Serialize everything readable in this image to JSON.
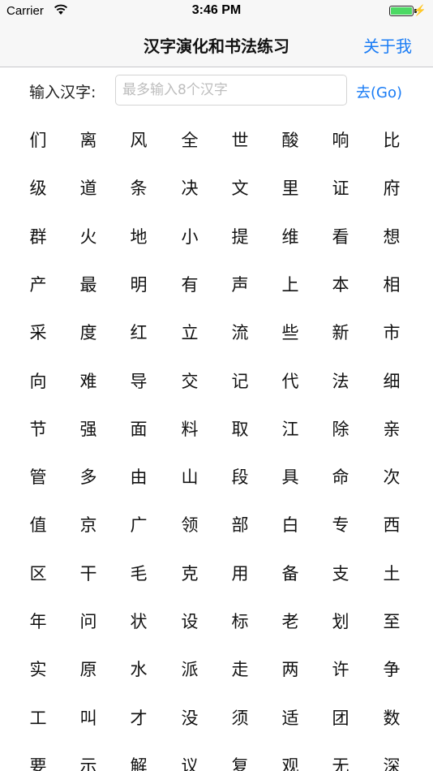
{
  "status_bar": {
    "carrier": "Carrier",
    "time": "3:46 PM",
    "wifi_icon": "wifi-icon",
    "battery_icon": "battery-icon",
    "charging_icon": "bolt-icon",
    "battery_color": "#4cd964",
    "charging_glyph": "⚡"
  },
  "nav": {
    "title": "汉字演化和书法练习",
    "about_label": "关于我",
    "accent_color": "#1a7cf5"
  },
  "search": {
    "label": "输入汉字:",
    "placeholder": "最多输入8个汉字",
    "value": "",
    "go_label": "去(Go)"
  },
  "characters": [
    [
      "们",
      "离",
      "风",
      "全",
      "世",
      "酸",
      "响",
      "比"
    ],
    [
      "级",
      "道",
      "条",
      "决",
      "文",
      "里",
      "证",
      "府"
    ],
    [
      "群",
      "火",
      "地",
      "小",
      "提",
      "维",
      "看",
      "想"
    ],
    [
      "产",
      "最",
      "明",
      "有",
      "声",
      "上",
      "本",
      "相"
    ],
    [
      "采",
      "度",
      "红",
      "立",
      "流",
      "些",
      "新",
      "市"
    ],
    [
      "向",
      "难",
      "导",
      "交",
      "记",
      "代",
      "法",
      "细"
    ],
    [
      "节",
      "强",
      "面",
      "料",
      "取",
      "江",
      "除",
      "亲"
    ],
    [
      "管",
      "多",
      "由",
      "山",
      "段",
      "具",
      "命",
      "次"
    ],
    [
      "值",
      "京",
      "广",
      "领",
      "部",
      "白",
      "专",
      "西"
    ],
    [
      "区",
      "干",
      "毛",
      "克",
      "用",
      "备",
      "支",
      "土"
    ],
    [
      "年",
      "问",
      "状",
      "设",
      "标",
      "老",
      "划",
      "至"
    ],
    [
      "实",
      "原",
      "水",
      "派",
      "走",
      "两",
      "许",
      "争"
    ],
    [
      "工",
      "叫",
      "才",
      "没",
      "须",
      "适",
      "团",
      "数"
    ],
    [
      "要",
      "示",
      "解",
      "议",
      "复",
      "观",
      "无",
      "深"
    ]
  ]
}
